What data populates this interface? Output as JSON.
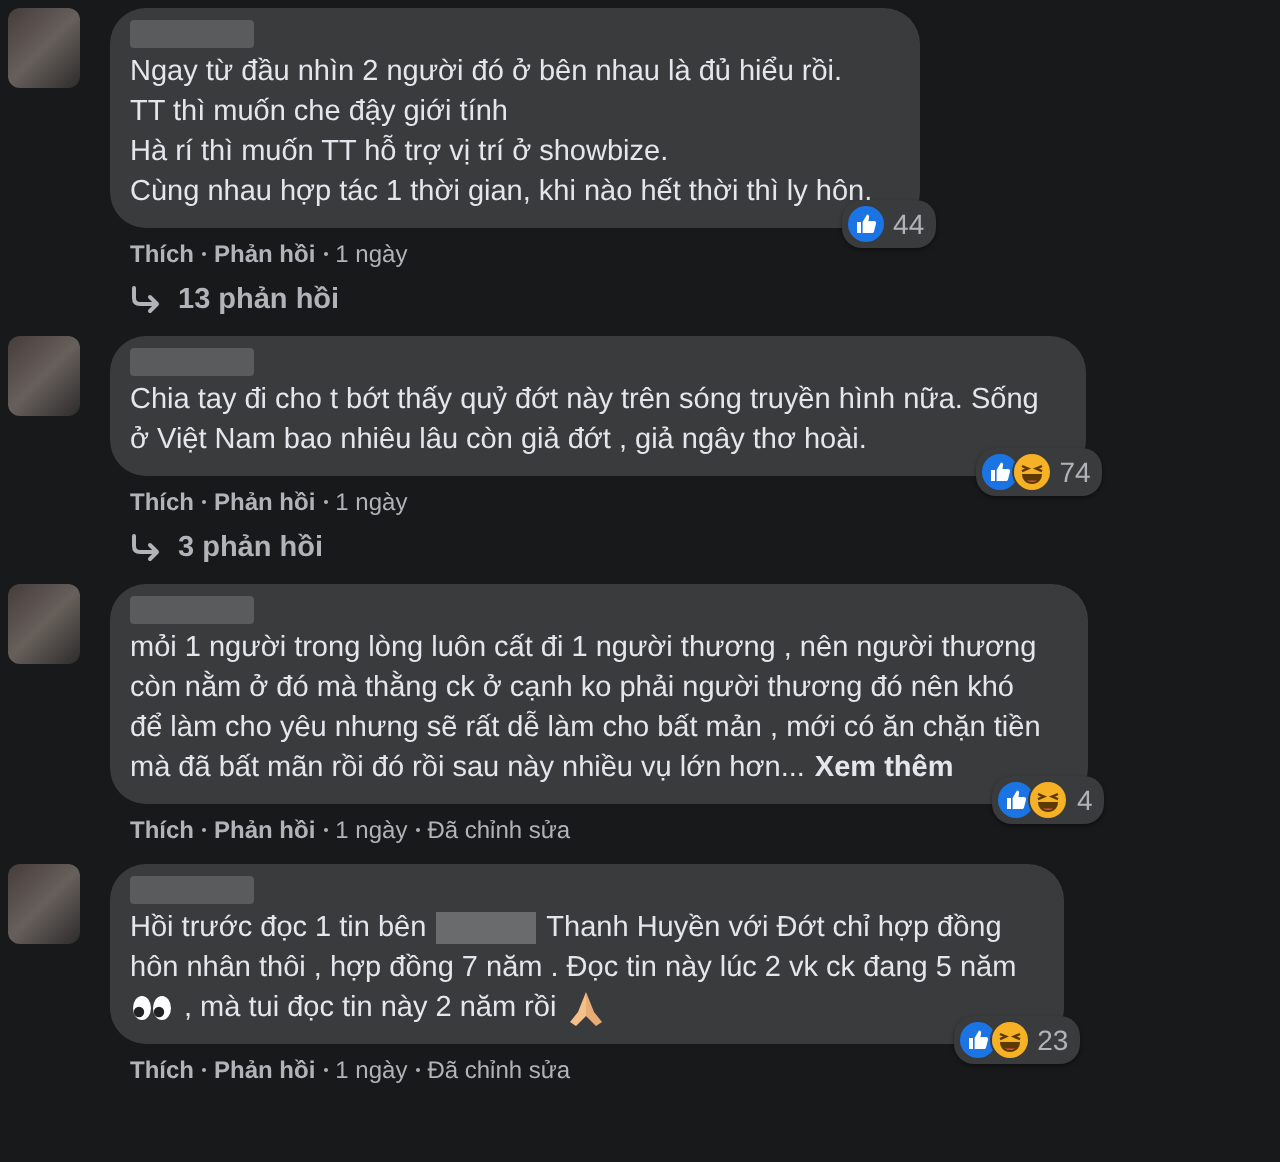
{
  "comments": [
    {
      "lines": [
        [
          {
            "kind": "text",
            "text": "Ngay từ đầu nhìn 2 người đó ở bên nhau là đủ hiểu rồi."
          }
        ],
        [
          {
            "kind": "text",
            "text": "TT thì muốn che đậy giới tính"
          }
        ],
        [
          {
            "kind": "text",
            "text": "Hà rí thì muốn TT hỗ trợ vị trí ở showbize."
          }
        ],
        [
          {
            "kind": "text",
            "text": "Cùng nhau hợp tác 1 thời gian, khi nào hết thời thì ly hôn."
          }
        ]
      ],
      "reactions": [
        {
          "kind": "like"
        }
      ],
      "reaction_count": "44",
      "actions": [
        "Thích",
        "Phản hồi",
        "1 ngày"
      ],
      "replies": "13 phản hồi"
    },
    {
      "lines": [
        [
          {
            "kind": "text",
            "text": "Chia tay đi cho t bớt thấy quỷ đớt này trên sóng truyền hình nữa. Sống"
          }
        ],
        [
          {
            "kind": "text",
            "text": "ở Việt Nam bao nhiêu lâu còn giả đớt , giả ngây thơ hoài."
          }
        ]
      ],
      "reactions": [
        {
          "kind": "like"
        },
        {
          "kind": "haha"
        }
      ],
      "reaction_count": "74",
      "actions": [
        "Thích",
        "Phản hồi",
        "1 ngày"
      ],
      "replies": "3 phản hồi"
    },
    {
      "lines": [
        [
          {
            "kind": "text",
            "text": "mỏi 1 người trong lòng luôn cất đi 1 người thương , nên người thương"
          }
        ],
        [
          {
            "kind": "text",
            "text": "còn nằm ở đó mà thằng ck ở cạnh ko phải người thương đó nên khó"
          }
        ],
        [
          {
            "kind": "text",
            "text": "để làm cho yêu nhưng sẽ rất dễ làm cho bất mản , mới có ăn chặn tiền"
          }
        ],
        [
          {
            "kind": "text",
            "text": "mà đã bất mãn rồi đó rồi sau này nhiều vụ lớn hơn..."
          },
          {
            "kind": "link",
            "text": "Xem thêm"
          }
        ]
      ],
      "reactions": [
        {
          "kind": "like"
        },
        {
          "kind": "haha"
        }
      ],
      "reaction_count": "4",
      "actions": [
        "Thích",
        "Phản hồi",
        "1 ngày",
        "Đã chỉnh sửa"
      ]
    },
    {
      "lines": [
        [
          {
            "kind": "text",
            "text": "Hồi trước đọc 1 tin bên"
          },
          {
            "kind": "blur"
          },
          {
            "kind": "text",
            "text": "Thanh Huyền với Đớt chỉ hợp đồng"
          }
        ],
        [
          {
            "kind": "text",
            "text": "hôn nhân thôi , hợp đồng 7 năm . Đọc tin này lúc 2 vk ck đang 5 năm"
          }
        ],
        [
          {
            "kind": "eyes"
          },
          {
            "kind": "text",
            "text": ", mà tui đọc tin này 2 năm rồi"
          },
          {
            "kind": "pray"
          }
        ]
      ],
      "reactions": [
        {
          "kind": "like"
        },
        {
          "kind": "haha"
        }
      ],
      "reaction_count": "23",
      "actions": [
        "Thích",
        "Phản hồi",
        "1 ngày",
        "Đã chỉnh sửa"
      ]
    }
  ]
}
